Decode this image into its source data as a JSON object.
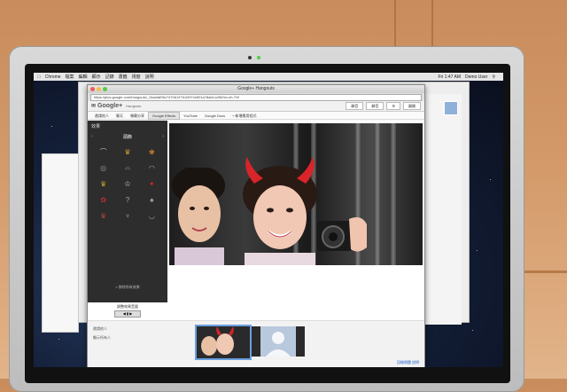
{
  "menubar": {
    "apple": "",
    "app": "Chrome",
    "items": [
      "檔案",
      "編輯",
      "顯示",
      "記錄",
      "書籤",
      "視窗",
      "說明"
    ],
    "clock": "Fri 1:47 AM",
    "user": "Demo User"
  },
  "browser": {
    "title": "Google+ Hangouts",
    "url": "https://plus.google.com/hangouts/_/3aa3af06c747b6137fc3497cb501a78ab1cc96/hn=zh-TW",
    "gbar_logo": "Google+",
    "gbar_sub": "Hangouts",
    "gbar_buttons": [
      "靜音",
      "靜音",
      "⚙",
      "離開"
    ],
    "apps": [
      "邀請他人",
      "聊天",
      "螢幕分享",
      "Google Effects",
      "YouTube",
      "Google Docs",
      "+ 新增應用程式"
    ]
  },
  "effects": {
    "title": "效果",
    "category": "頭飾",
    "items": [
      "⌒",
      "♛",
      "♚",
      "◎",
      "⌓",
      "◠",
      "♛",
      "♔",
      "✦",
      "✿",
      "?",
      "♠",
      "♛",
      "♆",
      "◡"
    ],
    "footer": "× 移除所有效果",
    "volume_label": "調整效果音量",
    "volume_ctrl": "◀ ▮ ▶"
  },
  "bottom": {
    "label1": "邀請他人",
    "label2": "顯示所有人",
    "links": "回報問題  說明"
  },
  "colors": {
    "devil_horns": "#d8242a",
    "selection": "#6aa0e0",
    "effects_bg": "#2d2d2d"
  }
}
